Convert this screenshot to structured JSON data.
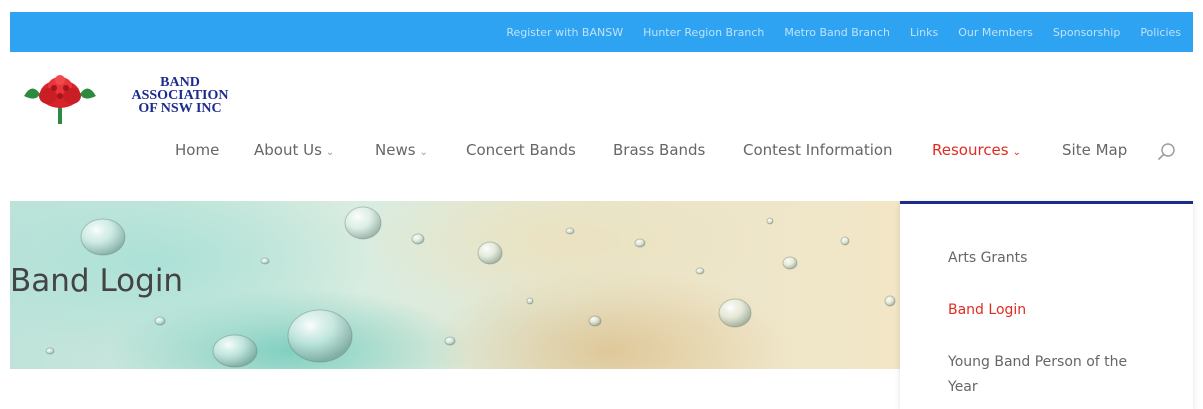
{
  "topbar": {
    "links": [
      "Register with BANSW",
      "Hunter Region Branch",
      "Metro Band Branch",
      "Links",
      "Our Members",
      "Sponsorship",
      "Policies"
    ]
  },
  "logo": {
    "line1": "BAND",
    "line2": "ASSOCIATION",
    "line3": "OF NSW INC"
  },
  "nav": {
    "items": [
      {
        "label": "Home",
        "caret": ""
      },
      {
        "label": "About Us",
        "caret": "⌄"
      },
      {
        "label": "News",
        "caret": "⌄"
      },
      {
        "label": "Concert Bands",
        "caret": ""
      },
      {
        "label": "Brass Bands",
        "caret": ""
      },
      {
        "label": "Contest Information",
        "caret": ""
      },
      {
        "label": "Resources",
        "caret": "⌄"
      },
      {
        "label": "Site Map",
        "caret": ""
      }
    ],
    "search_icon": "search-icon"
  },
  "hero": {
    "title": "Band Login"
  },
  "dropdown": {
    "items": [
      "Arts Grants",
      "Band Login",
      "Young Band Person of the Year"
    ]
  },
  "colors": {
    "topbar": "#2ea3f2",
    "active": "#e02b20",
    "dropdown_border": "#1c2b8c",
    "logo_text": "#1c2b8c"
  }
}
